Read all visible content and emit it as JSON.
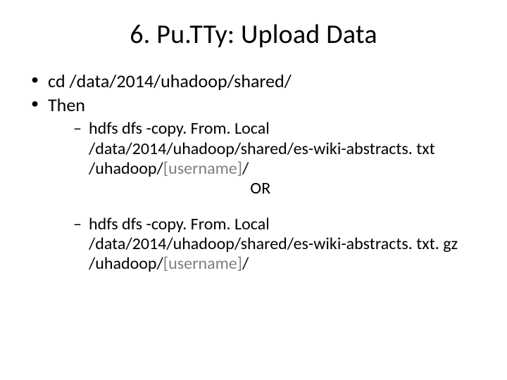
{
  "title": "6. Pu.TTy: Upload Data",
  "bullets": {
    "b1": "cd /data/2014/uhadoop/shared/",
    "b2": "Then"
  },
  "sub": {
    "s1a": "hdfs dfs -copy. From. Local",
    "s1b": "/data/2014/uhadoop/shared/es-wiki-abstracts. txt",
    "s1c_prefix": "/uhadoop/",
    "s1c_ph": "[username]",
    "s1c_suffix": "/",
    "or": "OR",
    "s2a": "hdfs dfs -copy. From. Local",
    "s2b": "/data/2014/uhadoop/shared/es-wiki-abstracts. txt. gz",
    "s2c_prefix": "/uhadoop/",
    "s2c_ph": "[username]",
    "s2c_suffix": "/"
  }
}
